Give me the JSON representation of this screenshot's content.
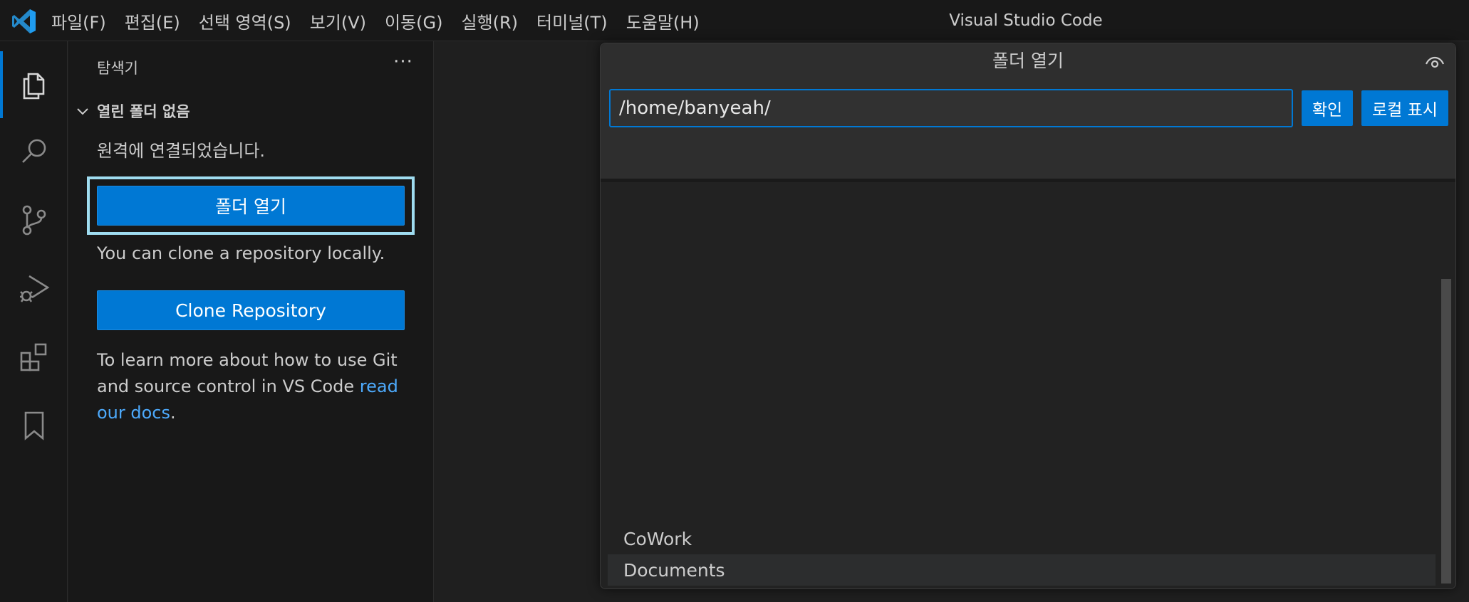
{
  "window": {
    "title": "Visual Studio Code"
  },
  "menu": [
    "파일(F)",
    "편집(E)",
    "선택 영역(S)",
    "보기(V)",
    "이동(G)",
    "실행(R)",
    "터미널(T)",
    "도움말(H)"
  ],
  "activity_bar": {
    "items": [
      {
        "name": "explorer",
        "icon": "files-icon",
        "active": true
      },
      {
        "name": "search",
        "icon": "search-icon"
      },
      {
        "name": "source-control",
        "icon": "source-control-icon"
      },
      {
        "name": "run-debug",
        "icon": "run-debug-icon"
      },
      {
        "name": "extensions",
        "icon": "extensions-icon"
      },
      {
        "name": "bookmarks",
        "icon": "bookmark-icon"
      }
    ]
  },
  "sidebar": {
    "title": "탐색기",
    "more": "···",
    "section": "열린 폴더 없음",
    "connected_text": "원격에 연결되었습니다.",
    "open_folder_button": "폴더 열기",
    "clone_text": "You can clone a repository locally.",
    "clone_button": "Clone Repository",
    "docs_text": "To learn more about how to use Git and source control in VS Code ",
    "docs_link": "read our docs",
    "docs_end": "."
  },
  "quick_pick": {
    "title": "폴더 열기",
    "input_value": "/home/banyeah/",
    "ok_button": "확인",
    "show_local_button": "로컬 표시",
    "items": [
      {
        "label": "CoWork",
        "selected": false
      },
      {
        "label": "Documents",
        "selected": true
      }
    ]
  },
  "colors": {
    "accent": "#0078d4",
    "focus_ring": "#9fdcf0",
    "link": "#4daafc"
  }
}
